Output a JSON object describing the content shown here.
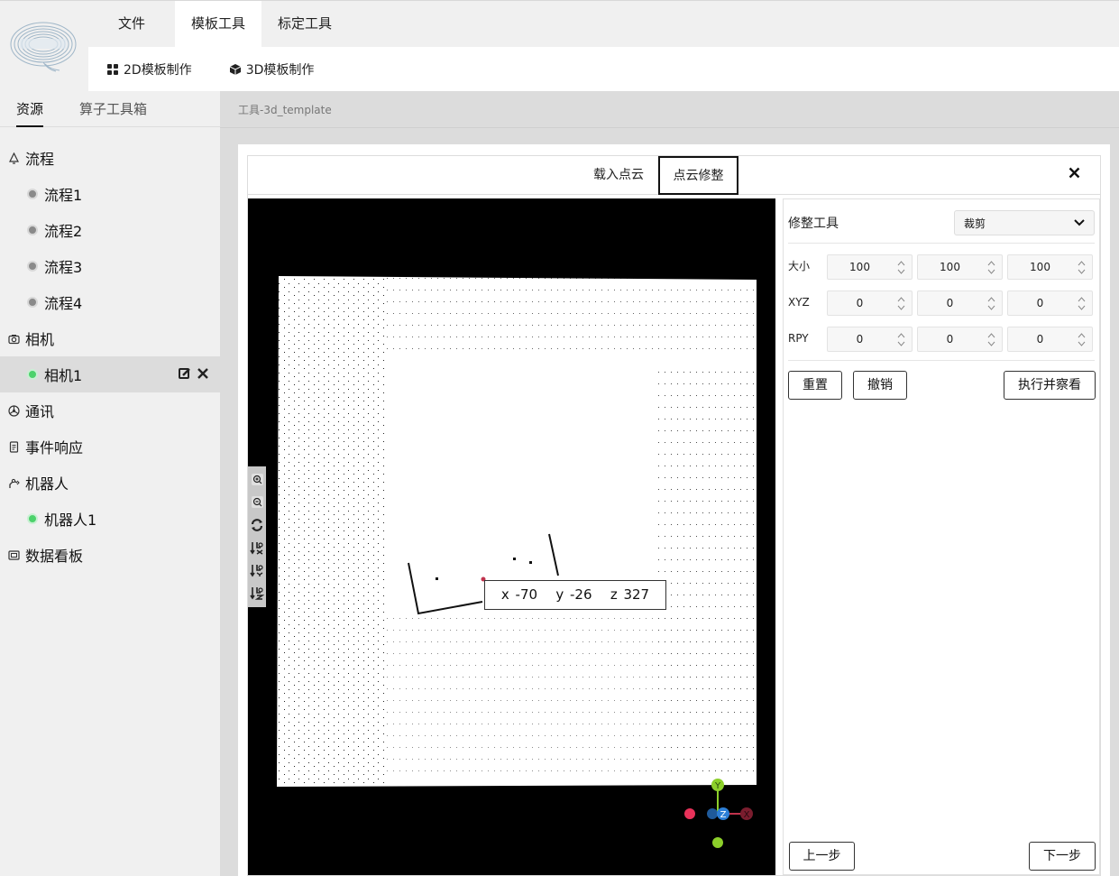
{
  "menu": {
    "items": [
      "文件",
      "模板工具",
      "标定工具"
    ]
  },
  "submenu": {
    "items": [
      "2D模板制作",
      "3D模板制作"
    ]
  },
  "sidebar": {
    "tabs": [
      "资源",
      "算子工具箱"
    ],
    "tree": {
      "flow": {
        "label": "流程",
        "children": [
          "流程1",
          "流程2",
          "流程3",
          "流程4"
        ]
      },
      "camera": {
        "label": "相机",
        "children": [
          "相机1"
        ]
      },
      "comm": {
        "label": "通讯"
      },
      "event": {
        "label": "事件响应"
      },
      "robot": {
        "label": "机器人",
        "children": [
          "机器人1"
        ]
      },
      "dashboard": {
        "label": "数据看板"
      }
    }
  },
  "breadcrumb": "工具-3d_template",
  "dialog": {
    "tabs": [
      "载入点云",
      "点云修整"
    ],
    "active_tab": "点云修整",
    "viewer": {
      "coord_x": "x -70",
      "coord_y": "y -26",
      "coord_z": "z 327",
      "axis_labels": {
        "x": "X",
        "y": "Y",
        "z": "Z"
      }
    },
    "panel": {
      "tool_label": "修整工具",
      "tool_value": "裁剪",
      "size_label": "大小",
      "size_values": [
        "100",
        "100",
        "100"
      ],
      "xyz_label": "XYZ",
      "xyz_values": [
        "0",
        "0",
        "0"
      ],
      "rpy_label": "RPY",
      "rpy_values": [
        "0",
        "0",
        "0"
      ],
      "reset_label": "重置",
      "undo_label": "撤销",
      "execute_label": "执行并察看",
      "prev_label": "上一步",
      "next_label": "下一步"
    }
  },
  "colors": {
    "status_green": "#4cd26b",
    "status_grey": "#8a8a8a",
    "axis_x": "#c0334d",
    "axis_y": "#8ccf2a",
    "axis_z": "#2d7fd6"
  }
}
